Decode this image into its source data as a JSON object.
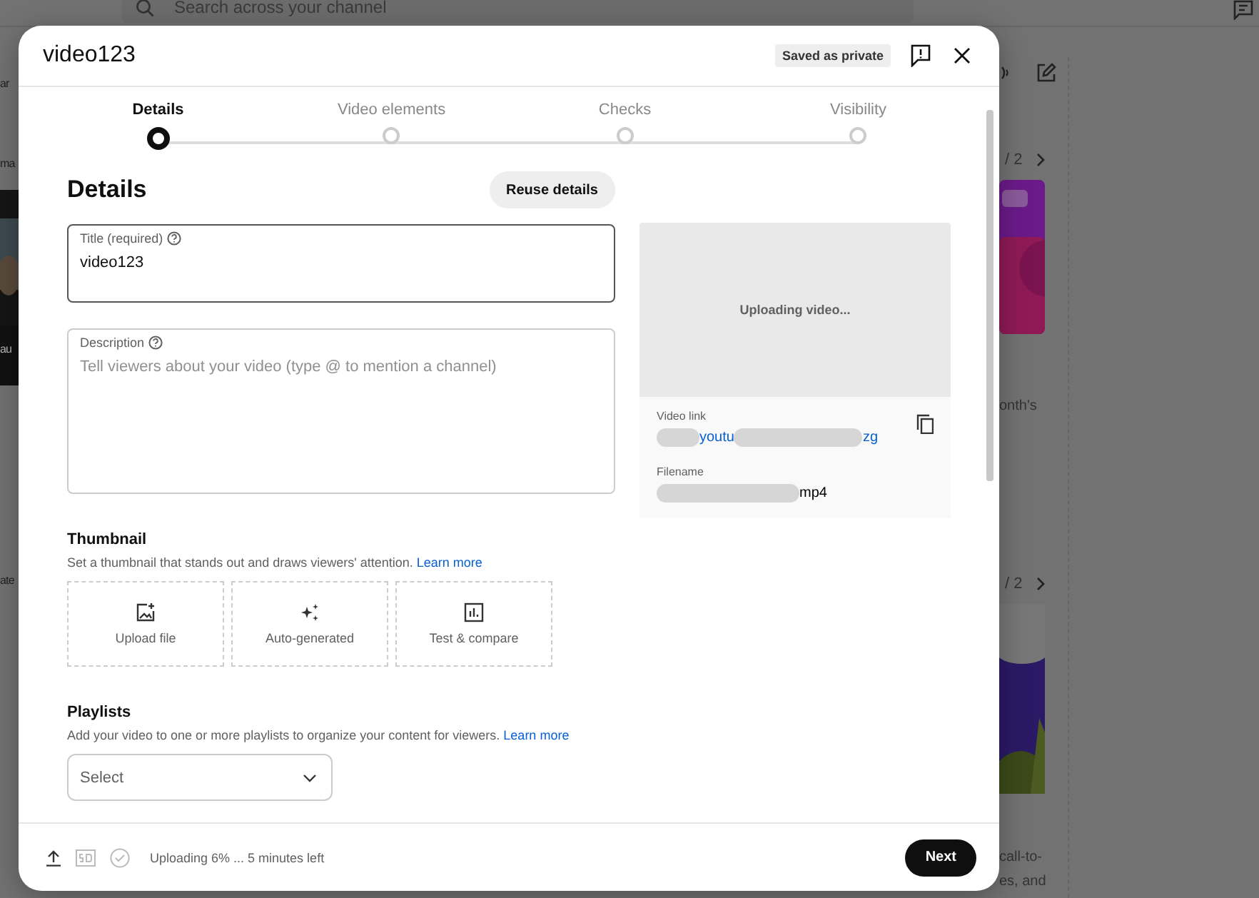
{
  "background": {
    "search": {
      "placeholder": "Search across your channel"
    },
    "fragments_left": [
      "ar",
      "ma",
      "au",
      "ate"
    ],
    "cards": [
      {
        "pager": "/ 2",
        "caption_lines": [
          "onth's"
        ]
      },
      {
        "pager": "/ 2",
        "caption_lines": [
          "call-to-",
          "es, and"
        ]
      }
    ]
  },
  "dialog": {
    "title": "video123",
    "save_status": "Saved as private",
    "steps": [
      {
        "label": "Details",
        "selected": true
      },
      {
        "label": "Video elements",
        "selected": false
      },
      {
        "label": "Checks",
        "selected": false
      },
      {
        "label": "Visibility",
        "selected": false
      }
    ],
    "heading": "Details",
    "reuse_button": "Reuse details",
    "fields": [
      {
        "label": "Title (required)",
        "value": "video123",
        "focused": true
      },
      {
        "label": "Description",
        "placeholder": "Tell viewers about your video (type @ to mention a channel)",
        "focused": false
      }
    ],
    "thumbnail": {
      "heading": "Thumbnail",
      "description": "Set a thumbnail that stands out and draws viewers' attention.",
      "learn_more": "Learn more",
      "options": [
        {
          "kind": "upload",
          "label": "Upload file"
        },
        {
          "kind": "auto",
          "label": "Auto-generated"
        },
        {
          "kind": "test",
          "label": "Test & compare"
        }
      ]
    },
    "playlists": {
      "heading": "Playlists",
      "description": "Add your video to one or more playlists to organize your content for viewers.",
      "learn_more": "Learn more",
      "select_placeholder": "Select"
    },
    "preview": {
      "status": "Uploading video...",
      "video_link_label": "Video link",
      "link_fragments": [
        "youtu",
        "zg"
      ],
      "filename_label": "Filename",
      "filename_fragment": "mp4"
    },
    "footer": {
      "status": "Uploading 6% ... 5 minutes left",
      "next": "Next"
    }
  }
}
